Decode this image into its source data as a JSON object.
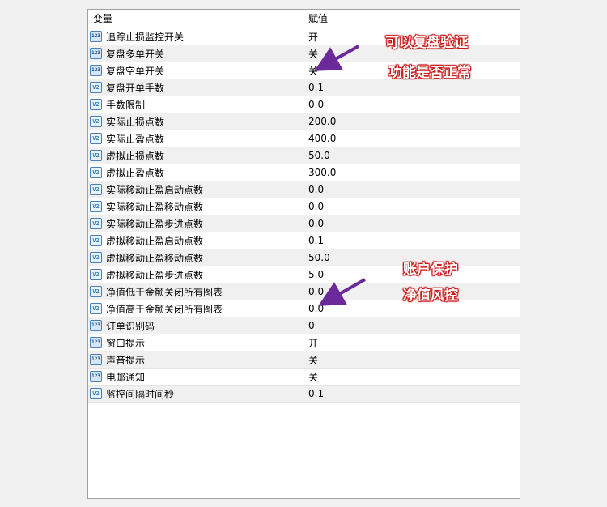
{
  "table": {
    "header_name": "变量",
    "header_value": "赋值",
    "rows": [
      {
        "icon": "int",
        "name": "追踪止损监控开关",
        "value": "开"
      },
      {
        "icon": "int",
        "name": "复盘多单开关",
        "value": "关"
      },
      {
        "icon": "int",
        "name": "复盘空单开关",
        "value": "关"
      },
      {
        "icon": "dbl",
        "name": "复盘开单手数",
        "value": "0.1"
      },
      {
        "icon": "dbl",
        "name": "手数限制",
        "value": "0.0"
      },
      {
        "icon": "dbl",
        "name": "实际止损点数",
        "value": "200.0"
      },
      {
        "icon": "dbl",
        "name": "实际止盈点数",
        "value": "400.0"
      },
      {
        "icon": "dbl",
        "name": "虚拟止损点数",
        "value": "50.0"
      },
      {
        "icon": "dbl",
        "name": "虚拟止盈点数",
        "value": "300.0"
      },
      {
        "icon": "dbl",
        "name": "实际移动止盈启动点数",
        "value": "0.0"
      },
      {
        "icon": "dbl",
        "name": "实际移动止盈移动点数",
        "value": "0.0"
      },
      {
        "icon": "dbl",
        "name": "实际移动止盈步进点数",
        "value": "0.0"
      },
      {
        "icon": "dbl",
        "name": "虚拟移动止盈启动点数",
        "value": "0.1"
      },
      {
        "icon": "dbl",
        "name": "虚拟移动止盈移动点数",
        "value": "50.0"
      },
      {
        "icon": "dbl",
        "name": "虚拟移动止盈步进点数",
        "value": "5.0"
      },
      {
        "icon": "dbl",
        "name": "净值低于金额关闭所有图表",
        "value": "0.0"
      },
      {
        "icon": "dbl",
        "name": "净值高于金额关闭所有图表",
        "value": "0.0"
      },
      {
        "icon": "int",
        "name": "订单识别码",
        "value": "0"
      },
      {
        "icon": "int",
        "name": "窗口提示",
        "value": "开"
      },
      {
        "icon": "int",
        "name": "声音提示",
        "value": "关"
      },
      {
        "icon": "int",
        "name": "电邮通知",
        "value": "关"
      },
      {
        "icon": "dbl",
        "name": "监控间隔时间秒",
        "value": "0.1"
      }
    ]
  },
  "icons": {
    "int": "123",
    "dbl": "V2"
  },
  "annotations": {
    "top_line1": "可以复盘验证",
    "top_line2": "功能是否正常",
    "bottom_line1": "账户保护",
    "bottom_line2": "净值风控"
  },
  "colors": {
    "annotation_text": "#ffffff",
    "annotation_outline": "#d31b1b",
    "arrow": "#6a2a9a"
  }
}
